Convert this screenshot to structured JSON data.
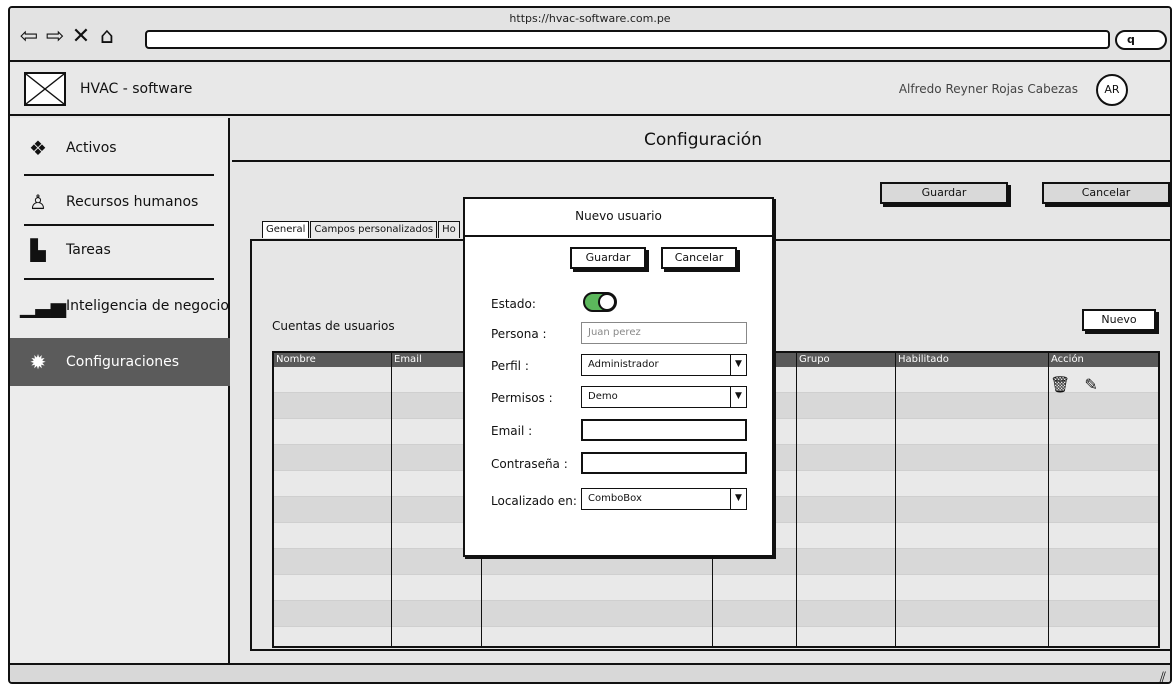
{
  "browser": {
    "url": "https://hvac-software.com.pe",
    "nav_icons": [
      "back-icon",
      "forward-icon",
      "close-icon",
      "home-icon"
    ],
    "search_icon": "search-icon"
  },
  "app": {
    "title": "HVAC - software",
    "user_name": "Alfredo Reyner Rojas Cabezas",
    "avatar_initials": "AR"
  },
  "sidebar": {
    "items": [
      {
        "label": "Activos",
        "icon": "cubes-icon"
      },
      {
        "label": "Recursos humanos",
        "icon": "person-icon"
      },
      {
        "label": "Tareas",
        "icon": "documents-icon"
      },
      {
        "label": "Inteligencia de negocio",
        "icon": "bar-chart-icon"
      },
      {
        "label": "Configuraciones",
        "icon": "gear-icon",
        "active": true
      }
    ]
  },
  "main": {
    "title": "Configuración",
    "save_label": "Guardar",
    "cancel_label": "Cancelar",
    "tabs": [
      "General",
      "Campos personalizados",
      "Ho"
    ],
    "section_label": "Cuentas de usuarios",
    "new_label": "Nuevo",
    "table": {
      "columns": [
        "Nombre",
        "Email",
        "",
        "",
        "Grupo",
        "Habilitado",
        "Acción"
      ],
      "action_icons": [
        "trash-icon",
        "edit-icon"
      ]
    }
  },
  "modal": {
    "title": "Nuevo usuario",
    "save_label": "Guardar",
    "cancel_label": "Cancelar",
    "fields": {
      "estado_label": "Estado:",
      "estado_on": true,
      "persona_label": "Persona :",
      "persona_placeholder": "Juan perez",
      "perfil_label": "Perfil :",
      "perfil_value": "Administrador",
      "permisos_label": "Permisos :",
      "permisos_value": "Demo",
      "email_label": "Email :",
      "password_label": "Contraseña :",
      "localizado_label": "Localizado en:",
      "localizado_value": "ComboBox"
    }
  },
  "colors": {
    "toggle_on": "#5cb85c",
    "active_nav": "#5b5b5b"
  }
}
